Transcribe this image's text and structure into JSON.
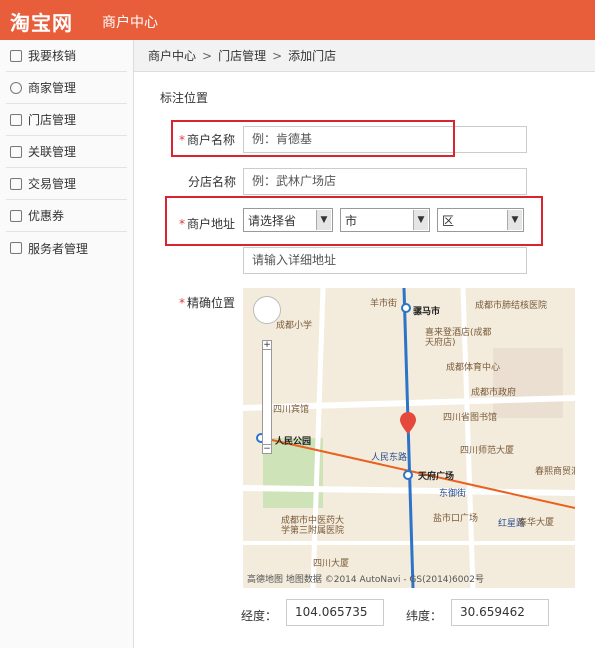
{
  "header": {
    "logo": "淘宝网",
    "title": "商户中心"
  },
  "sidebar": {
    "items": [
      {
        "label": "我要核销",
        "icon": "list-icon"
      },
      {
        "label": "商家管理",
        "icon": "user-icon"
      },
      {
        "label": "门店管理",
        "icon": "store-icon"
      },
      {
        "label": "关联管理",
        "icon": "list-icon"
      },
      {
        "label": "交易管理",
        "icon": "list-icon"
      },
      {
        "label": "优惠券",
        "icon": "list-icon"
      },
      {
        "label": "服务者管理",
        "icon": "list-icon"
      }
    ]
  },
  "breadcrumb": {
    "items": [
      "商户中心",
      "门店管理",
      "添加门店"
    ],
    "separator": ">"
  },
  "form": {
    "section_title": "标注位置",
    "required_mark": "*",
    "merchant_name": {
      "label": "商户名称",
      "placeholder": "例：肯德基"
    },
    "branch_name": {
      "label": "分店名称",
      "placeholder": "例：武林广场店"
    },
    "address": {
      "label": "商户地址",
      "province": "请选择省",
      "city": "市",
      "district": "区",
      "detail_placeholder": "请输入详细地址"
    },
    "location": {
      "label": "精确位置"
    },
    "longitude": {
      "label": "经度：",
      "value": "104.065735"
    },
    "latitude": {
      "label": "纬度：",
      "value": "30.659462"
    }
  },
  "map": {
    "labels": {
      "l1": "羊市街",
      "l2": "骡马市",
      "l3": "成都市肺结核医院",
      "l4": "喜来登酒店(成都天府店)",
      "l5": "成都体育中心",
      "l6": "成都市政府",
      "l7": "四川省图书馆",
      "l8": "天府广场",
      "l9": "人民公园",
      "l10": "四川宾馆",
      "l11": "盐市口广场",
      "l12": "春熙商贸汇广场",
      "l13": "成都市中医药大学第三附属医院",
      "l14": "四川大厦",
      "l15": "人民东路",
      "l16": "东御街",
      "l17": "红星路",
      "l18": "泰华大厦",
      "l19": "成都小学",
      "l20": "四川师范大厦"
    },
    "footer": "高德地图 地图数据 ©2014 AutoNavi - GS(2014)6002号"
  }
}
